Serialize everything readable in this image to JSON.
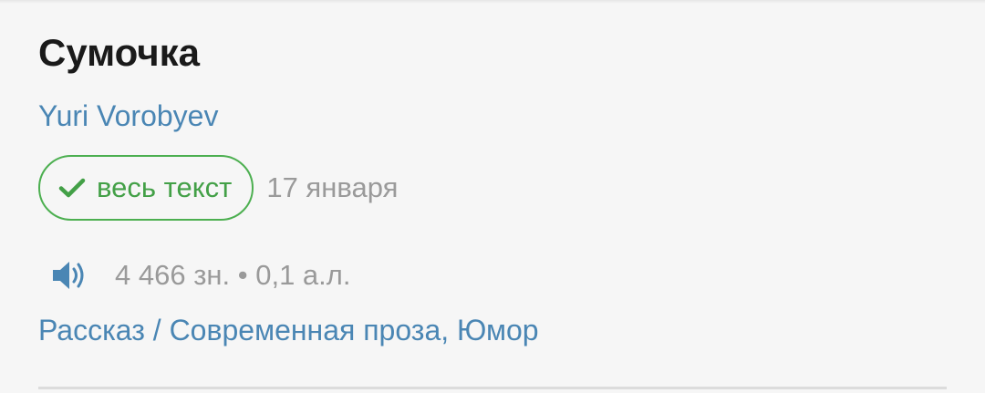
{
  "work": {
    "title": "Сумочка",
    "author": "Yuri Vorobyev",
    "status_badge": "весь текст",
    "date": "17 января",
    "stats": "4 466 зн. • 0,1 а.л.",
    "genres": "Рассказ / Современная проза, Юмор"
  },
  "icons": {
    "status": "check-icon",
    "audio": "speaker-icon"
  },
  "colors": {
    "accent": "#4a86b4",
    "success": "#43a047",
    "muted": "#9a9a9a",
    "title": "#1a1a1a",
    "background": "#f6f6f6"
  }
}
